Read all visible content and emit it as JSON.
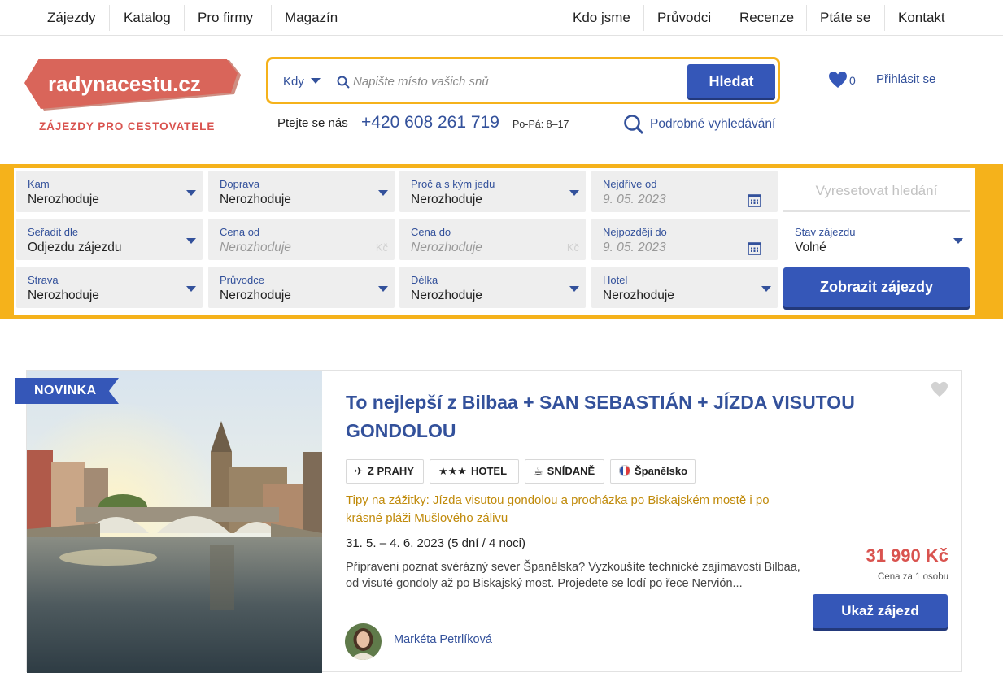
{
  "topnav": {
    "left": [
      "Zájezdy",
      "Katalog",
      "Pro firmy",
      "Magazín"
    ],
    "right": [
      "Kdo jsme",
      "Průvodci",
      "Recenze",
      "Ptáte se",
      "Kontakt"
    ]
  },
  "header": {
    "logo_text": "radynacestu.cz",
    "logo_tagline": "ZÁJEZDY PRO CESTOVATELE",
    "search": {
      "when_label": "Kdy",
      "placeholder": "Napište místo vašich snů",
      "button": "Hledat"
    },
    "call_label": "Ptejte se nás",
    "phone": "+420 608 261 719",
    "hours": "Po-Pá: 8–17",
    "advanced_search": "Podrobné vyhledávání",
    "favorites_count": "0",
    "login": "Přihlásit se"
  },
  "filters": {
    "kam": {
      "label": "Kam",
      "value": "Nerozhoduje"
    },
    "doprava": {
      "label": "Doprava",
      "value": "Nerozhoduje"
    },
    "proc": {
      "label": "Proč a s kým jedu",
      "value": "Nerozhoduje"
    },
    "nejdrive": {
      "label": "Nejdříve od",
      "value": "9. 05. 2023"
    },
    "reset": "Vyresetovat hledání",
    "seradit": {
      "label": "Seřadit dle",
      "value": "Odjezdu zájezdu"
    },
    "cena_od": {
      "label": "Cena od",
      "value": "Nerozhoduje",
      "unit": "Kč"
    },
    "cena_do": {
      "label": "Cena do",
      "value": "Nerozhoduje",
      "unit": "Kč"
    },
    "nejpozdeji": {
      "label": "Nejpozději do",
      "value": "9. 05. 2023"
    },
    "stav": {
      "label": "Stav zájezdu",
      "value": "Volné"
    },
    "strava": {
      "label": "Strava",
      "value": "Nerozhoduje"
    },
    "pruvodce": {
      "label": "Průvodce",
      "value": "Nerozhoduje"
    },
    "delka": {
      "label": "Délka",
      "value": "Nerozhoduje"
    },
    "hotel": {
      "label": "Hotel",
      "value": "Nerozhoduje"
    },
    "show_button": "Zobrazit zájezdy"
  },
  "tour": {
    "ribbon": "NOVINKA",
    "title": "To nejlepší z Bilbaa + SAN SEBASTIÁN + JÍZDA VISUTOU GONDOLOU",
    "badges": [
      {
        "icon": "plane-icon",
        "text": "Z PRAHY"
      },
      {
        "icon": "stars-icon",
        "text": "HOTEL"
      },
      {
        "icon": "cup-icon",
        "text": "SNÍDANĚ"
      },
      {
        "icon": "flag-icon",
        "text": "Španělsko"
      }
    ],
    "tips": "Tipy na zážitky: Jízda visutou gondolou a procházka po Biskajském mostě i po krásné pláži Mušlového zálivu",
    "dates": "31. 5. – 4. 6. 2023 (5 dní / 4 noci)",
    "description": "Připraveni poznat svérázný sever Španělska? Vyzkoušíte technické zajímavosti Bilbaa, od visuté gondoly až po Biskajský most. Projedete se lodí po řece Nervión...",
    "guide": "Markéta Petrlíková",
    "price": "31 990 Kč",
    "price_note": "Cena za 1 osobu",
    "button": "Ukaž zájezd"
  },
  "colors": {
    "brand_blue": "#3557b8",
    "accent_yellow": "#f5b21b",
    "logo_red": "#d9534f",
    "tips_orange": "#c08a0a"
  }
}
